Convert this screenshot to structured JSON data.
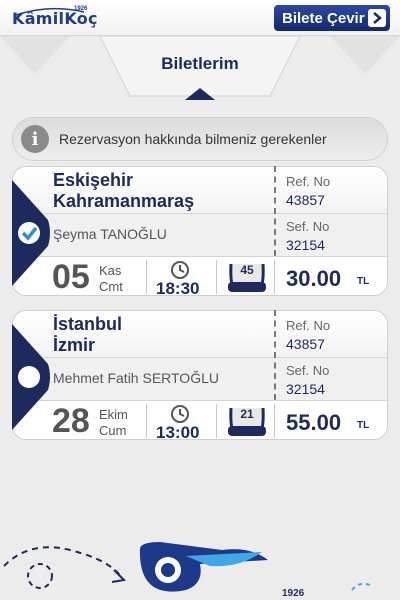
{
  "app": {
    "logo_text": "KâmilKoç",
    "logo_sup": "1926",
    "convert_label": "Bilete Çevir"
  },
  "header": {
    "title": "Biletlerim"
  },
  "info": {
    "text": "Rezervasyon hakkında bilmeniz gerekenler"
  },
  "tickets": [
    {
      "from": "Eskişehir",
      "to": "Kahramanmaraş",
      "passenger": "Şeyma TANOĞLU",
      "ref_label": "Ref. No",
      "ref_no": "43857",
      "sef_label": "Sef. No",
      "sef_no": "32154",
      "day": "05",
      "month": "Kas",
      "weekday": "Cmt",
      "time": "18:30",
      "seat": "45",
      "price": "30.00",
      "currency": "TL",
      "selected": true
    },
    {
      "from": "İstanbul",
      "to": "İzmir",
      "passenger": "Mehmet Fatih SERTOĞLU",
      "ref_label": "Ref. No",
      "ref_no": "43857",
      "sef_label": "Sef. No",
      "sef_no": "32154",
      "day": "28",
      "month": "Ekim",
      "weekday": "Cum",
      "time": "13:00",
      "seat": "21",
      "price": "55.00",
      "currency": "TL",
      "selected": false
    }
  ],
  "footer": {
    "year": "1926"
  },
  "colors": {
    "navy": "#1d2a5c",
    "brand_blue": "#1e3c8c",
    "check_blue": "#2f8fd6"
  }
}
